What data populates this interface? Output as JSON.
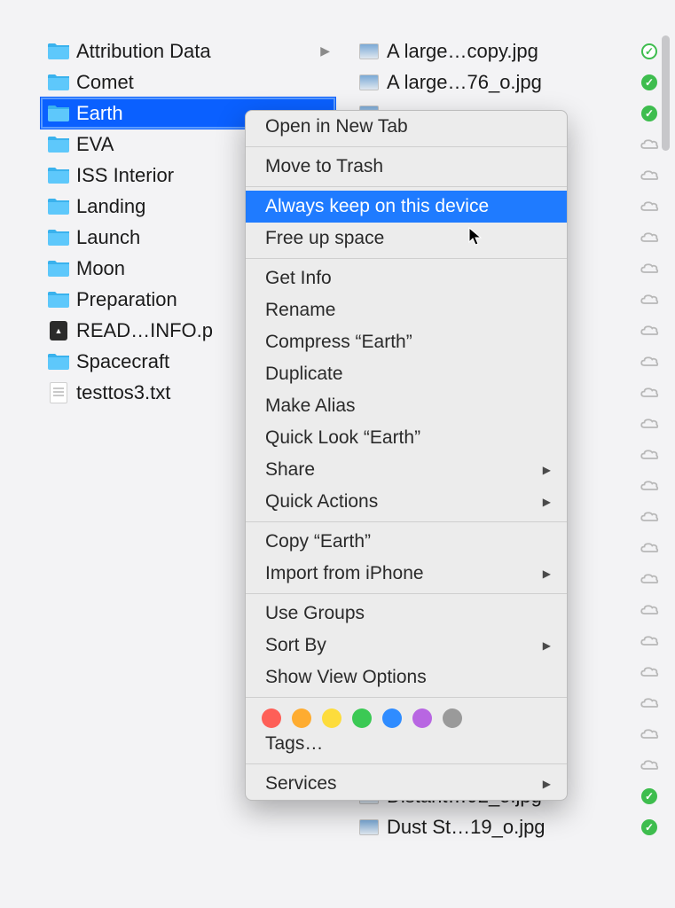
{
  "col1": {
    "items": [
      {
        "type": "folder",
        "label": "Attribution Data",
        "chevron": true
      },
      {
        "type": "folder",
        "label": "Comet"
      },
      {
        "type": "folder",
        "label": "Earth",
        "selected": true
      },
      {
        "type": "folder",
        "label": "EVA"
      },
      {
        "type": "folder",
        "label": "ISS Interior"
      },
      {
        "type": "folder",
        "label": "Landing"
      },
      {
        "type": "folder",
        "label": "Launch"
      },
      {
        "type": "folder",
        "label": "Moon"
      },
      {
        "type": "folder",
        "label": "Preparation"
      },
      {
        "type": "pdf",
        "label": "READ…INFO.p"
      },
      {
        "type": "folder",
        "label": "Spacecraft"
      },
      {
        "type": "txt",
        "label": "testtos3.txt"
      }
    ]
  },
  "col2": {
    "items": [
      {
        "type": "img",
        "label": "A large…copy.jpg",
        "status": "check-outline"
      },
      {
        "type": "img",
        "label": "A large…76_o.jpg",
        "status": "check-filled"
      },
      {
        "type": "img",
        "label": "",
        "status": "check-filled"
      },
      {
        "type": "img",
        "label": "",
        "status": "cloud"
      },
      {
        "type": "img",
        "label": "",
        "status": "cloud"
      },
      {
        "type": "img",
        "label": "",
        "status": "cloud"
      },
      {
        "type": "img",
        "label": "",
        "status": "cloud"
      },
      {
        "type": "img",
        "label": "",
        "status": "cloud"
      },
      {
        "type": "img",
        "label": "",
        "status": "cloud"
      },
      {
        "type": "img",
        "label": "",
        "status": "cloud"
      },
      {
        "type": "img",
        "label": "",
        "status": "cloud"
      },
      {
        "type": "img",
        "label": "",
        "status": "cloud"
      },
      {
        "type": "img",
        "label": "",
        "status": "cloud"
      },
      {
        "type": "img",
        "label": "",
        "status": "cloud"
      },
      {
        "type": "img",
        "label": "",
        "status": "cloud"
      },
      {
        "type": "img",
        "label": "",
        "status": "cloud"
      },
      {
        "type": "img",
        "label": "",
        "status": "cloud"
      },
      {
        "type": "img",
        "label": "",
        "status": "cloud"
      },
      {
        "type": "img",
        "label": "",
        "status": "cloud"
      },
      {
        "type": "img",
        "label": "",
        "status": "cloud"
      },
      {
        "type": "img",
        "label": "",
        "status": "cloud"
      },
      {
        "type": "img",
        "label": "",
        "status": "cloud"
      },
      {
        "type": "img",
        "label": "",
        "status": "cloud"
      },
      {
        "type": "img",
        "label": "",
        "status": "cloud"
      },
      {
        "type": "img",
        "label": "Distant…92_o.jpg",
        "status": "check-filled"
      },
      {
        "type": "img",
        "label": "Dust St…19_o.jpg",
        "status": "check-filled"
      }
    ]
  },
  "menu": {
    "groups": [
      [
        {
          "label": "Open in New Tab"
        }
      ],
      [
        {
          "label": "Move to Trash"
        }
      ],
      [
        {
          "label": "Always keep on this device",
          "highlight": true
        },
        {
          "label": "Free up space"
        }
      ],
      [
        {
          "label": "Get Info"
        },
        {
          "label": "Rename"
        },
        {
          "label": "Compress “Earth”"
        },
        {
          "label": "Duplicate"
        },
        {
          "label": "Make Alias"
        },
        {
          "label": "Quick Look “Earth”"
        },
        {
          "label": "Share",
          "sub": true
        },
        {
          "label": "Quick Actions",
          "sub": true
        }
      ],
      [
        {
          "label": "Copy “Earth”"
        },
        {
          "label": "Import from iPhone",
          "sub": true
        }
      ],
      [
        {
          "label": "Use Groups"
        },
        {
          "label": "Sort By",
          "sub": true
        },
        {
          "label": "Show View Options"
        }
      ]
    ],
    "tag_colors": [
      "red",
      "orange",
      "yellow",
      "green",
      "blue",
      "purple",
      "gray"
    ],
    "tags_label": "Tags…",
    "services_label": "Services"
  }
}
